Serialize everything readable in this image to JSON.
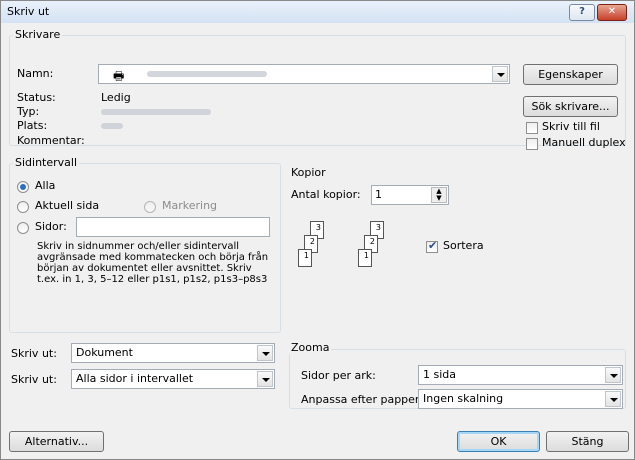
{
  "title": "Skriv ut",
  "titlebar": {
    "help": "?",
    "close": "✕"
  },
  "printer": {
    "group_label": "Skrivare",
    "name_label": "Namn:",
    "status_label": "Status:",
    "status_value": "Ledig",
    "type_label": "Typ:",
    "location_label": "Plats:",
    "comment_label": "Kommentar:",
    "properties_button": "Egenskaper",
    "find_printer_button": "Sök skrivare...",
    "print_to_file": "Skriv till fil",
    "manual_duplex": "Manuell duplex",
    "print_to_file_checked": false,
    "manual_duplex_checked": false
  },
  "page_range": {
    "group_label": "Sidintervall",
    "all": "Alla",
    "current_page": "Aktuell sida",
    "selection": "Markering",
    "pages": "Sidor:",
    "pages_value": "",
    "help_text": "Skriv in sidnummer och/eller sidintervall avgränsade med kommatecken och börja från början av dokumentet eller avsnittet. Skriv t.ex. in 1, 3, 5–12 eller p1s1, p1s2, p1s3–p8s3",
    "selected": "all"
  },
  "copies": {
    "group_label": "Kopior",
    "count_label": "Antal kopior:",
    "count_value": "1",
    "collate_label": "Sortera",
    "collate_checked": true
  },
  "print_what": {
    "label": "Skriv ut:",
    "value": "Dokument"
  },
  "print": {
    "label": "Skriv ut:",
    "value": "Alla sidor i intervallet"
  },
  "zoom": {
    "group_label": "Zooma",
    "pages_per_sheet_label": "Sidor per ark:",
    "pages_per_sheet_value": "1 sida",
    "scale_label": "Anpassa efter papper:",
    "scale_value": "Ingen skalning"
  },
  "footer": {
    "options_button": "Alternativ...",
    "ok_button": "OK",
    "close_button": "Stäng"
  }
}
